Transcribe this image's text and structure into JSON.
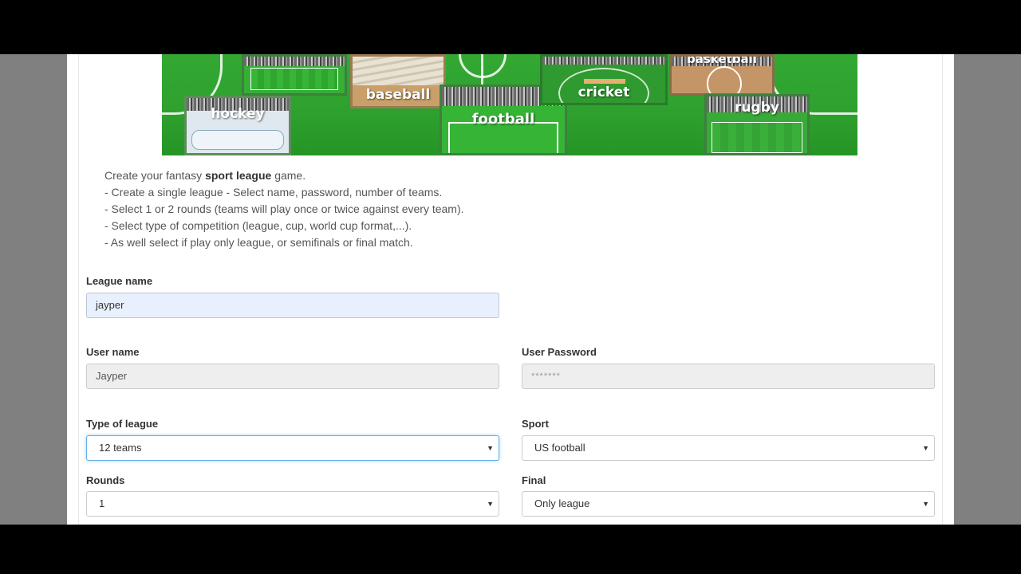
{
  "banner": {
    "tiles": {
      "hockey": "hockey",
      "baseball": "baseball",
      "football": "football",
      "cricket": "cricket",
      "basketball": "basketball",
      "rugby": "rugby"
    }
  },
  "description": {
    "intro_prefix": "Create your fantasy ",
    "intro_bold": "sport league",
    "intro_suffix": " game.",
    "lines": [
      "- Create a single league - Select name, password, number of teams.",
      "- Select 1 or 2 rounds (teams will play once or twice against every team).",
      "- Select type of competition (league, cup, world cup format,...).",
      "- As well select if play only league, or semifinals or final match."
    ]
  },
  "form": {
    "league_name": {
      "label": "League name",
      "value": "jayper"
    },
    "user_name": {
      "label": "User name",
      "value": "Jayper"
    },
    "user_password": {
      "label": "User Password",
      "value": "*******"
    },
    "type_of_league": {
      "label": "Type of league",
      "value": "12 teams"
    },
    "sport": {
      "label": "Sport",
      "value": "US football"
    },
    "rounds": {
      "label": "Rounds",
      "value": "1"
    },
    "final": {
      "label": "Final",
      "value": "Only league"
    }
  },
  "icons": {
    "dropdown": "caret-down-icon"
  },
  "colors": {
    "field_green": "#2ea02e",
    "focus_blue": "#66afe9",
    "autofill": "#e8f0fe"
  }
}
